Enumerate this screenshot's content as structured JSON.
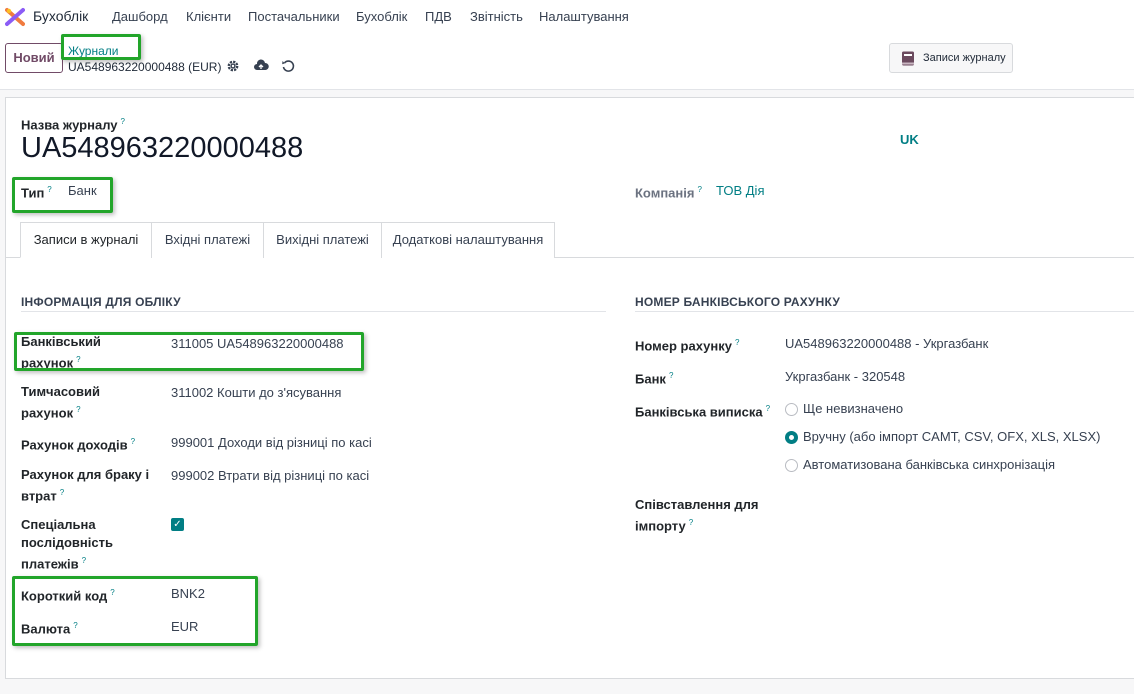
{
  "nav": {
    "app_title": "Бухоблік",
    "menu": [
      "Дашборд",
      "Клієнти",
      "Постачальники",
      "Бухоблік",
      "ПДВ",
      "Звітність",
      "Налаштування"
    ]
  },
  "control_panel": {
    "new_button": "Новий",
    "breadcrumb_parent": "Журнали",
    "breadcrumb_record": "UA548963220000488 (EUR)",
    "journal_entries_button": "Записи журналу"
  },
  "header": {
    "name_label": "Назва журналу",
    "name_value": "UA548963220000488",
    "lang_badge": "UK",
    "type_label": "Тип",
    "type_value": "Банк",
    "company_label": "Компанія",
    "company_value": "ТОВ Дія"
  },
  "tabs": [
    "Записи в журналі",
    "Вхідні платежі",
    "Вихідні платежі",
    "Додаткові налаштування"
  ],
  "left_section": {
    "title": "ІНФОРМАЦІЯ ДЛЯ ОБЛІКУ",
    "fields": [
      {
        "label_lines": [
          "Банківський",
          "рахунок"
        ],
        "value": "311005 UA548963220000488"
      },
      {
        "label_lines": [
          "Тимчасовий",
          "рахунок"
        ],
        "value": "311002 Кошти до з'ясування"
      },
      {
        "label_lines": [
          "Рахунок доходів"
        ],
        "value": "999001 Доходи від різниці по касі"
      },
      {
        "label_lines": [
          "Рахунок для браку і",
          "втрат"
        ],
        "value": "999002 Втрати від різниці по касі"
      },
      {
        "label_lines": [
          "Спеціальна",
          "послідовність",
          "платежів"
        ],
        "value": "checked"
      },
      {
        "label_lines": [
          "Короткий код"
        ],
        "value": "BNK2"
      },
      {
        "label_lines": [
          "Валюта"
        ],
        "value": "EUR"
      }
    ]
  },
  "right_section": {
    "title": "НОМЕР БАНКІВСЬКОГО РАХУНКУ",
    "account_label": "Номер рахунку",
    "account_value": "UA548963220000488 - Укргазбанк",
    "bank_label": "Банк",
    "bank_value": "Укргазбанк - 320548",
    "statement_label": "Банківська виписка",
    "statement_options": [
      "Ще невизначено",
      "Вручну (або імпорт CAMT, CSV, OFX, XLS, XLSX)",
      "Автоматизована банківська синхронізація"
    ],
    "statement_selected": 1,
    "import_label_lines": [
      "Співставлення для",
      "імпорту"
    ]
  },
  "colors": {
    "accent": "#017e84",
    "brand": "#714b67",
    "highlight": "#22a52a"
  }
}
